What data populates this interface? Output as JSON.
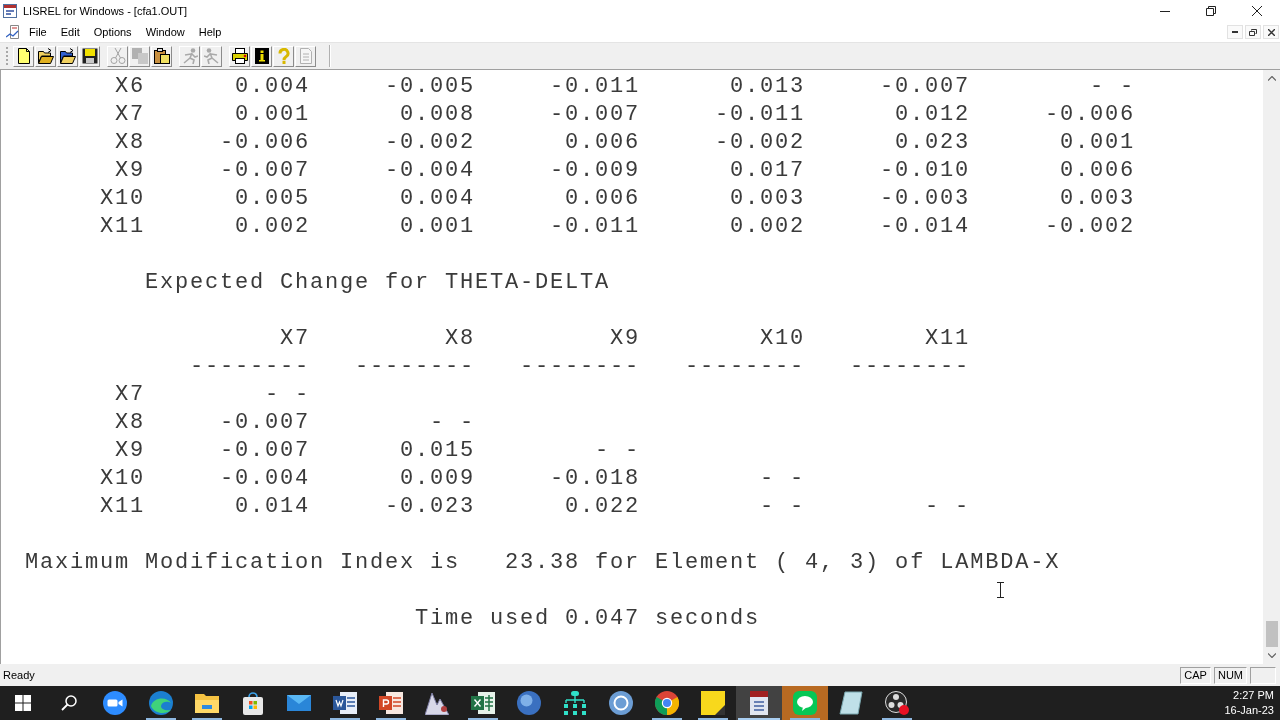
{
  "window": {
    "title": "LISREL for Windows - [cfa1.OUT]"
  },
  "menu": [
    "File",
    "Edit",
    "Options",
    "Window",
    "Help"
  ],
  "toolbar": [
    [
      {
        "disabled": false
      },
      {
        "disabled": false
      },
      {
        "disabled": false
      },
      {
        "disabled": false
      }
    ],
    [
      {
        "disabled": true
      },
      {
        "disabled": true
      },
      {
        "disabled": false
      }
    ],
    [
      {
        "disabled": true
      },
      {
        "disabled": true
      }
    ],
    [
      {
        "disabled": false
      },
      {
        "disabled": false
      },
      {
        "disabled": false
      },
      {
        "disabled": true
      }
    ]
  ],
  "output": {
    "table_1": {
      "rows": [
        {
          "label": "X6",
          "cells": [
            "0.004",
            "-0.005",
            "-0.011",
            "0.013",
            "-0.007",
            "- -"
          ]
        },
        {
          "label": "X7",
          "cells": [
            "0.001",
            "0.008",
            "-0.007",
            "-0.011",
            "0.012",
            "-0.006"
          ]
        },
        {
          "label": "X8",
          "cells": [
            "-0.006",
            "-0.002",
            "0.006",
            "-0.002",
            "0.023",
            "0.001"
          ]
        },
        {
          "label": "X9",
          "cells": [
            "-0.007",
            "-0.004",
            "-0.009",
            "0.017",
            "-0.010",
            "0.006"
          ]
        },
        {
          "label": "X10",
          "cells": [
            "0.005",
            "0.004",
            "0.006",
            "0.003",
            "-0.003",
            "0.003"
          ]
        },
        {
          "label": "X11",
          "cells": [
            "0.002",
            "0.001",
            "-0.011",
            "0.002",
            "-0.014",
            "-0.002"
          ]
        }
      ]
    },
    "heading": "Expected Change for THETA-DELTA",
    "table_2": {
      "columns": [
        {
          "label": "X7",
          "underline": "--------"
        },
        {
          "label": "X8",
          "underline": "--------"
        },
        {
          "label": "X9",
          "underline": "--------"
        },
        {
          "label": "X10",
          "underline": "--------"
        },
        {
          "label": "X11",
          "underline": "--------"
        }
      ],
      "rows": [
        {
          "label": "X7",
          "cells": [
            "- -"
          ]
        },
        {
          "label": "X8",
          "cells": [
            "-0.007",
            "- -"
          ]
        },
        {
          "label": "X9",
          "cells": [
            "-0.007",
            "0.015",
            "- -"
          ]
        },
        {
          "label": "X10",
          "cells": [
            "-0.004",
            "0.009",
            "-0.018",
            "- -"
          ]
        },
        {
          "label": "X11",
          "cells": [
            "0.014",
            "-0.023",
            "0.022",
            "- -",
            "- -"
          ]
        }
      ]
    },
    "max_index": "Maximum Modification Index is   23.38 for Element ( 4, 3) of LAMBDA-X",
    "time_used": "Time used 0.047 seconds"
  },
  "status_bar": {
    "text": "Ready",
    "indicators": [
      "CAP",
      "NUM"
    ]
  },
  "taskbar": {
    "apps": [
      {
        "running": false,
        "selected": false,
        "attention": false
      },
      {
        "running": true,
        "selected": false,
        "attention": false
      },
      {
        "running": true,
        "selected": false,
        "attention": false
      },
      {
        "running": false,
        "selected": false,
        "attention": false
      },
      {
        "running": false,
        "selected": false,
        "attention": false
      },
      {
        "running": true,
        "selected": false,
        "attention": false
      },
      {
        "running": true,
        "selected": false,
        "attention": false
      },
      {
        "running": false,
        "selected": false,
        "attention": false
      },
      {
        "running": true,
        "selected": false,
        "attention": false
      },
      {
        "running": false,
        "selected": false,
        "attention": false
      },
      {
        "running": false,
        "selected": false,
        "attention": false
      },
      {
        "running": false,
        "selected": false,
        "attention": false
      },
      {
        "running": true,
        "selected": false,
        "attention": false
      },
      {
        "running": true,
        "selected": false,
        "attention": false
      },
      {
        "running": true,
        "selected": true,
        "attention": false
      },
      {
        "running": true,
        "selected": false,
        "attention": true
      },
      {
        "running": false,
        "selected": false,
        "attention": false
      },
      {
        "running": true,
        "selected": false,
        "attention": false
      }
    ],
    "time": "2:27 PM",
    "date": "16-Jan-23"
  }
}
